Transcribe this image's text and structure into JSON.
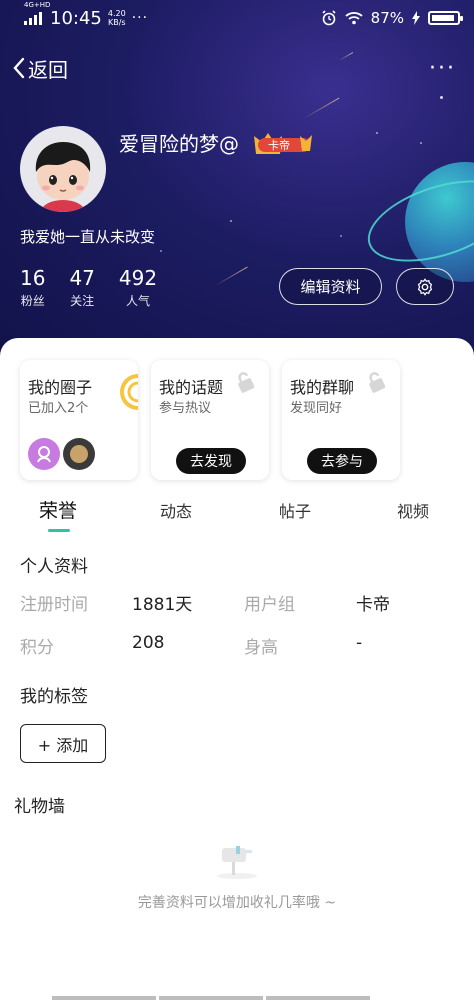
{
  "status_bar": {
    "network_label": "4G+HD",
    "time": "10:45",
    "speed_value": "4.20",
    "speed_unit": "KB/s",
    "dots": "···",
    "battery": "87%"
  },
  "nav": {
    "back_label": "返回",
    "more_label": "···"
  },
  "profile": {
    "username": "爱冒险的梦@",
    "badge": "卡帝",
    "bio": "我爱她一直从未改变",
    "stats": [
      {
        "num": "16",
        "label": "粉丝"
      },
      {
        "num": "47",
        "label": "关注"
      },
      {
        "num": "492",
        "label": "人气"
      }
    ],
    "edit_label": "编辑资料"
  },
  "cards": [
    {
      "title": "我的圈子",
      "subtitle": "已加入2个"
    },
    {
      "title": "我的话题",
      "subtitle": "参与热议",
      "button": "去发现"
    },
    {
      "title": "我的群聊",
      "subtitle": "发现同好",
      "button": "去参与"
    }
  ],
  "tabs": [
    "荣誉",
    "动态",
    "帖子",
    "视频"
  ],
  "personal_info": {
    "title": "个人资料",
    "rows": [
      {
        "label1": "注册时间",
        "value1": "1881天",
        "label2": "用户组",
        "value2": "卡帝"
      },
      {
        "label1": "积分",
        "value1": "208",
        "label2": "身高",
        "value2": "-"
      }
    ]
  },
  "tags": {
    "title": "我的标签",
    "add_label": "+ 添加"
  },
  "gift_wall": {
    "title": "礼物墙",
    "empty_text": "完善资料可以增加收礼几率哦 ~"
  },
  "colors": {
    "accent": "#2bc4a6",
    "hero_bg": "#1c1c62"
  }
}
